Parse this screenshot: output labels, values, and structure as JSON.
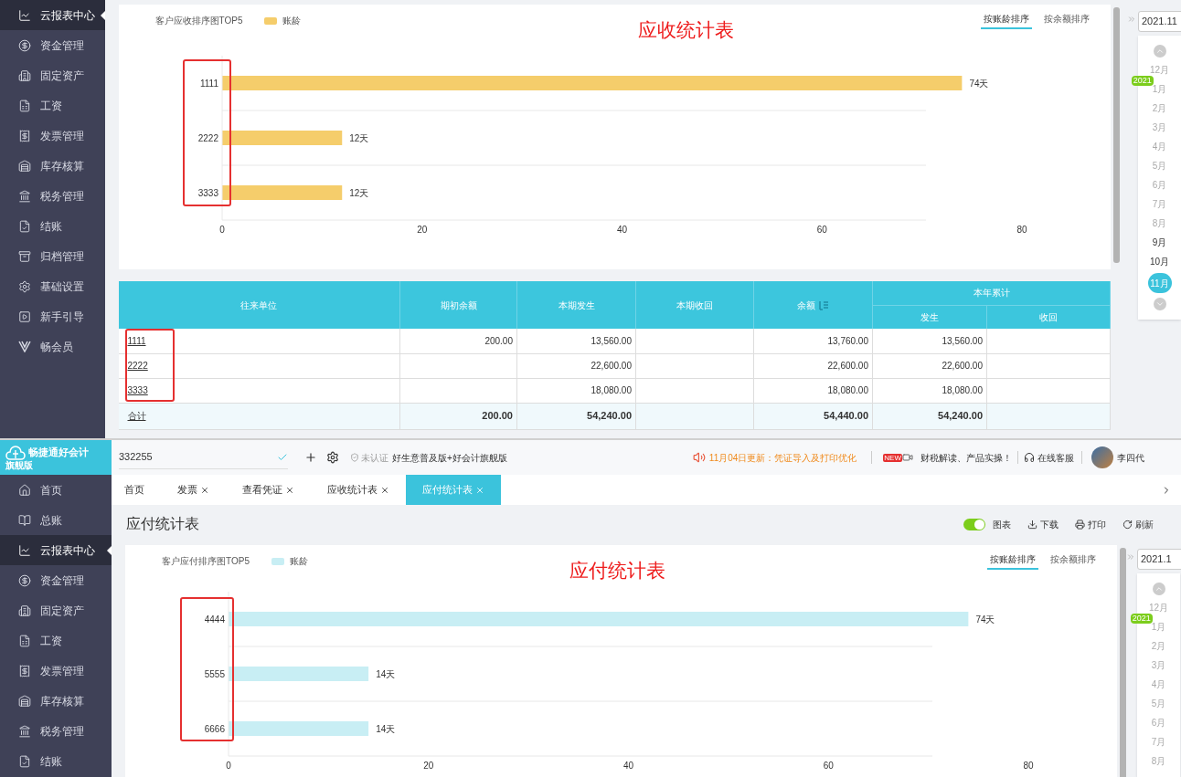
{
  "receivable_view": {
    "sidebar": {
      "items": [
        {
          "label": "云报表中心",
          "selected": true
        },
        {
          "label": "资金管理",
          "selected": false
        },
        {
          "label": "固定资产",
          "selected": false
        },
        {
          "label": "工资",
          "selected": false
        },
        {
          "label": "发票管理",
          "selected": false
        },
        {
          "label": "库存核算",
          "selected": false
        },
        {
          "label": "税务管理",
          "selected": false
        },
        {
          "label": "结账",
          "selected": false
        },
        {
          "label": "归档管理",
          "selected": false
        },
        {
          "label": "基础设置",
          "selected": false
        },
        {
          "label": "新手引导",
          "selected": false
        },
        {
          "label": "畅会员",
          "selected": false
        }
      ]
    },
    "annotation_title": "应收统计表",
    "chart": {
      "sort_options": [
        {
          "label": "按账龄排序",
          "selected": true
        },
        {
          "label": "按余额排序",
          "selected": false
        }
      ],
      "chart_data": {
        "type": "bar",
        "orientation": "horizontal",
        "title": "客户应收排序图TOP5",
        "categories": [
          "1111",
          "2222",
          "3333"
        ],
        "series": [
          {
            "name": "账龄",
            "color": "#f5cd6b",
            "values": [
              74,
              12,
              12
            ]
          }
        ],
        "xlim": [
          0,
          80
        ],
        "xticks": [
          0,
          20,
          40,
          60,
          80
        ],
        "value_labels": [
          "74天",
          "12天",
          "12天"
        ]
      }
    },
    "table": {
      "columns": [
        "往来单位",
        "期初余额",
        "本期发生",
        "本期收回",
        "余额"
      ],
      "group_header": "本年累计",
      "group_columns": [
        "发生",
        "收回"
      ],
      "rows": [
        {
          "kind": "data",
          "cells": [
            "1111",
            "200.00",
            "13,560.00",
            null,
            "13,760.00",
            "13,560.00",
            null
          ]
        },
        {
          "kind": "data",
          "cells": [
            "2222",
            null,
            "22,600.00",
            null,
            "22,600.00",
            "22,600.00",
            null
          ]
        },
        {
          "kind": "data",
          "cells": [
            "3333",
            null,
            "18,080.00",
            null,
            "18,080.00",
            "18,080.00",
            null
          ]
        },
        {
          "kind": "total",
          "cells": [
            "合计",
            "200.00",
            "54,240.00",
            null,
            "54,440.00",
            "54,240.00",
            null
          ]
        }
      ]
    },
    "month_picker": {
      "value": "2021.11",
      "months": [
        {
          "label": "12月",
          "selected": false
        },
        {
          "label": "1月",
          "year_badge": "2021",
          "selected": false
        },
        {
          "label": "2月",
          "selected": false
        },
        {
          "label": "3月",
          "selected": false
        },
        {
          "label": "4月",
          "selected": false
        },
        {
          "label": "5月",
          "selected": false
        },
        {
          "label": "6月",
          "selected": false
        },
        {
          "label": "7月",
          "selected": false
        },
        {
          "label": "8月",
          "selected": false
        },
        {
          "label": "9月",
          "selected": false
        },
        {
          "label": "10月",
          "selected": false
        },
        {
          "label": "11月",
          "selected": true
        }
      ]
    }
  },
  "payable_view": {
    "app": {
      "logo": "畅捷通好会计",
      "edition": "旗舰版"
    },
    "top_bar": {
      "company": "332255",
      "certification": "未认证",
      "product": "好生意普及版+好会计旗舰版",
      "notice": "11月04日更新：凭证导入及打印优化",
      "promo_badge": "NEW",
      "promo": "财税解读、产品实操！",
      "support": "在线客服",
      "user": "李四代"
    },
    "sidebar": {
      "items": [
        {
          "label": "首页",
          "selected": false
        },
        {
          "label": "总账",
          "selected": false
        },
        {
          "label": "云报表中心",
          "selected": true
        },
        {
          "label": "资金管理",
          "selected": false
        },
        {
          "label": "固定资产",
          "selected": false
        },
        {
          "label": "工资",
          "selected": false
        },
        {
          "label": "发票管理",
          "selected": false
        },
        {
          "label": "库存核算",
          "selected": false
        },
        {
          "label": "税务管理",
          "selected": false
        },
        {
          "label": "结账",
          "selected": false
        }
      ]
    },
    "tabs": [
      {
        "label": "首页",
        "closable": false,
        "selected": false
      },
      {
        "label": "发票",
        "closable": true,
        "selected": false
      },
      {
        "label": "查看凭证",
        "closable": true,
        "selected": false
      },
      {
        "label": "应收统计表",
        "closable": true,
        "selected": false
      },
      {
        "label": "应付统计表",
        "closable": true,
        "selected": true
      }
    ],
    "page_title": "应付统计表",
    "toolbar": {
      "chart_toggle": {
        "label": "图表",
        "on": true
      },
      "buttons": [
        {
          "kind": "download",
          "label": "下载"
        },
        {
          "kind": "print",
          "label": "打印"
        },
        {
          "kind": "refresh",
          "label": "刷新"
        }
      ]
    },
    "annotation_title": "应付统计表",
    "chart": {
      "sort_options": [
        {
          "label": "按账龄排序",
          "selected": true
        },
        {
          "label": "按余额排序",
          "selected": false
        }
      ],
      "chart_data": {
        "type": "bar",
        "orientation": "horizontal",
        "title": "客户应付排序图TOP5",
        "categories": [
          "4444",
          "5555",
          "6666"
        ],
        "series": [
          {
            "name": "账龄",
            "color": "#c8eef4",
            "values": [
              74,
              14,
              14
            ]
          }
        ],
        "xlim": [
          0,
          80
        ],
        "xticks": [
          0,
          20,
          40,
          60,
          80
        ],
        "value_labels": [
          "74天",
          "14天",
          "14天"
        ]
      }
    },
    "month_picker": {
      "value": "2021.1",
      "months": [
        {
          "label": "12月",
          "selected": false
        },
        {
          "label": "1月",
          "year_badge": "2021",
          "selected": false
        },
        {
          "label": "2月",
          "selected": false
        },
        {
          "label": "3月",
          "selected": false
        },
        {
          "label": "4月",
          "selected": false
        },
        {
          "label": "5月",
          "selected": false
        },
        {
          "label": "6月",
          "selected": false
        },
        {
          "label": "7月",
          "selected": false
        },
        {
          "label": "8月",
          "selected": false
        }
      ]
    }
  }
}
